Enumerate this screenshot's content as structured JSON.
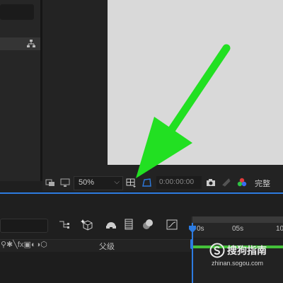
{
  "viewer": {
    "zoom": "50%",
    "timecode": "0:00:00:00",
    "resolution": "完整"
  },
  "timeline": {
    "ruler_labels": [
      "0s",
      "05s",
      "10"
    ],
    "parent_column": "父级",
    "switch_icons": "⚲✱╲fx▣◐◑⬡"
  },
  "watermark": {
    "name": "搜狗指南",
    "url": "zhinan.sogou.com"
  },
  "colors": {
    "accent_blue": "#2d7be0",
    "arrow_green": "#22e022",
    "work_area_green": "#44c13a",
    "comp_background": "#d9d9d9"
  },
  "icons": [
    "flowchart-icon",
    "region-of-interest-icon",
    "monitor-icon",
    "grid-guides-icon",
    "toggle-transparency-grid-icon",
    "camera-snapshot-icon",
    "show-snapshot-icon",
    "color-channels-icon",
    "nested-comp-icon",
    "draft-3d-icon",
    "shy-layers-icon",
    "frame-blending-icon",
    "motion-blur-icon",
    "graph-editor-icon"
  ]
}
